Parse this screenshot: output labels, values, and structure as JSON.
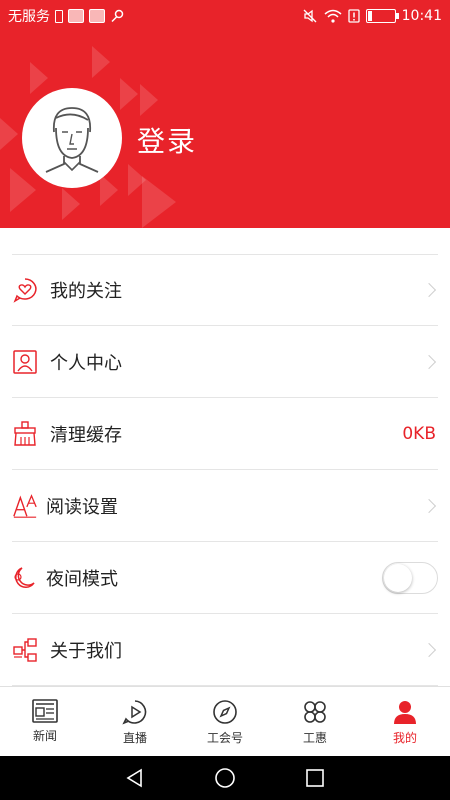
{
  "status_bar": {
    "carrier": "无服务",
    "time": "10:41"
  },
  "header": {
    "login_label": "登录"
  },
  "menu": {
    "items": [
      {
        "label": "我的关注",
        "icon": "heart-chat-icon"
      },
      {
        "label": "个人中心",
        "icon": "person-card-icon"
      },
      {
        "label": "清理缓存",
        "icon": "broom-icon",
        "value": "0KB"
      },
      {
        "label": "阅读设置",
        "icon": "font-size-icon"
      },
      {
        "label": "夜间模式",
        "icon": "moon-icon",
        "toggle": false
      },
      {
        "label": "关于我们",
        "icon": "org-chart-icon"
      }
    ]
  },
  "tabbar": {
    "tabs": [
      {
        "label": "新闻",
        "icon": "news-icon"
      },
      {
        "label": "直播",
        "icon": "play-icon"
      },
      {
        "label": "工会号",
        "icon": "compass-icon"
      },
      {
        "label": "工惠",
        "icon": "command-icon"
      },
      {
        "label": "我的",
        "icon": "person-icon",
        "active": true
      }
    ]
  },
  "colors": {
    "accent": "#e8232a",
    "text": "#222222",
    "divider": "#e5e5e5"
  }
}
